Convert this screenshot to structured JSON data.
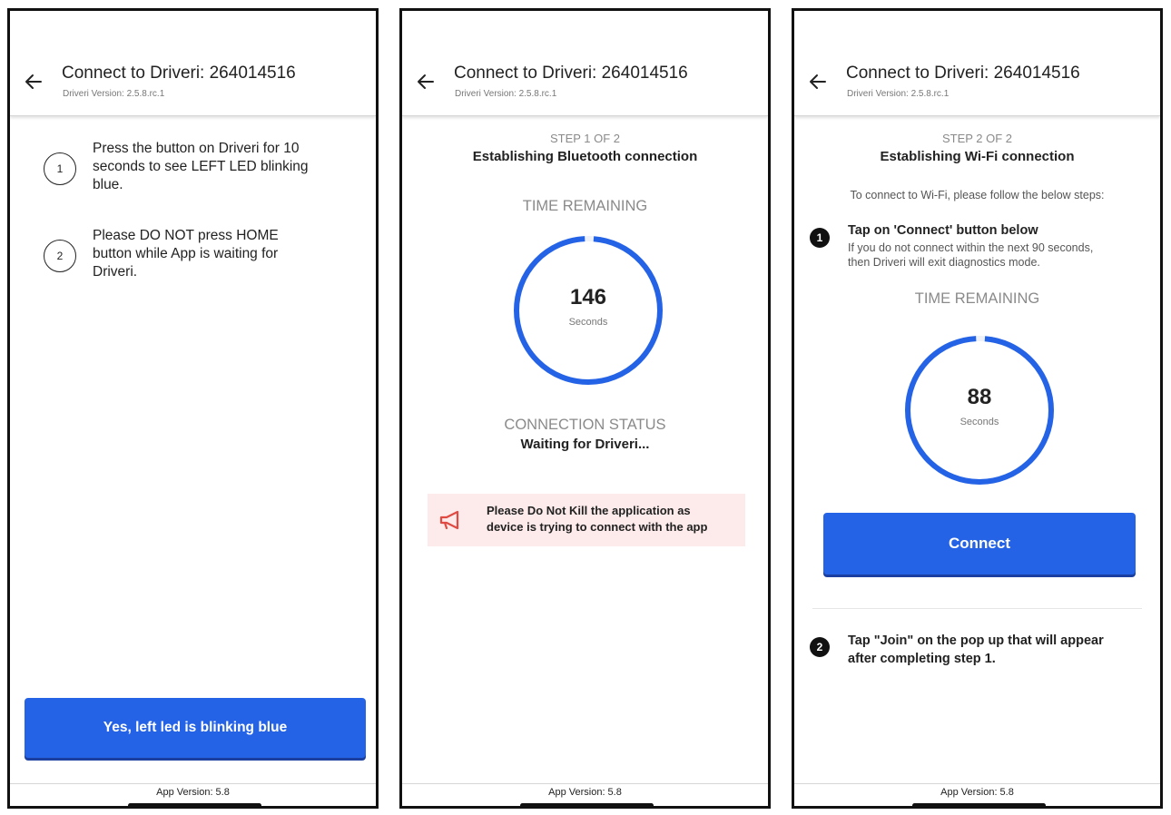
{
  "screens": [
    {
      "header": {
        "title": "Connect to Driveri: 264014516",
        "subtitle": "Driveri Version: 2.5.8.rc.1"
      },
      "instructions": [
        {
          "number": "1",
          "lines": [
            "Press the button on Driveri for 10",
            "seconds to see LEFT LED blinking",
            "blue."
          ]
        },
        {
          "number": "2",
          "lines": [
            "Please DO NOT press HOME",
            "button while App is waiting for",
            "Driveri."
          ]
        }
      ],
      "confirm_button": "Yes, left led is blinking blue",
      "footer": "App Version: 5.8"
    },
    {
      "header": {
        "title": "Connect to Driveri: 264014516",
        "subtitle": "Driveri Version: 2.5.8.rc.1"
      },
      "step_label": "STEP 1 OF 2",
      "step_heading": "Establishing Bluetooth connection",
      "time_label": "TIME REMAINING",
      "timer": {
        "value": "146",
        "unit": "Seconds",
        "progress": 0.98
      },
      "status_label": "CONNECTION STATUS",
      "status_value": "Waiting for Driveri...",
      "warning": [
        "Please Do Not Kill the application as",
        "device is trying to connect with the app"
      ],
      "footer": "App Version: 5.8"
    },
    {
      "header": {
        "title": "Connect to Driveri: 264014516",
        "subtitle": "Driveri Version: 2.5.8.rc.1"
      },
      "step_label": "STEP 2 OF 2",
      "step_heading": "Establishing Wi-Fi connection",
      "intro": "To connect to Wi-Fi, please follow the below steps:",
      "step1": {
        "number": "1",
        "title": "Tap on 'Connect' button below",
        "desc": [
          "If you do not connect within the next 90 seconds,",
          "then Driveri will exit diagnostics mode."
        ]
      },
      "time_label": "TIME REMAINING",
      "timer": {
        "value": "88",
        "unit": "Seconds",
        "progress": 0.98
      },
      "connect_button": "Connect",
      "step2": {
        "number": "2",
        "lines": [
          "Tap \"Join\" on the pop up that will appear",
          "after completing step 1."
        ]
      },
      "footer": "App Version: 5.8"
    }
  ],
  "colors": {
    "accent": "#2563e6",
    "warning_bg": "#fdeaea",
    "warning_icon": "#e04a43"
  }
}
